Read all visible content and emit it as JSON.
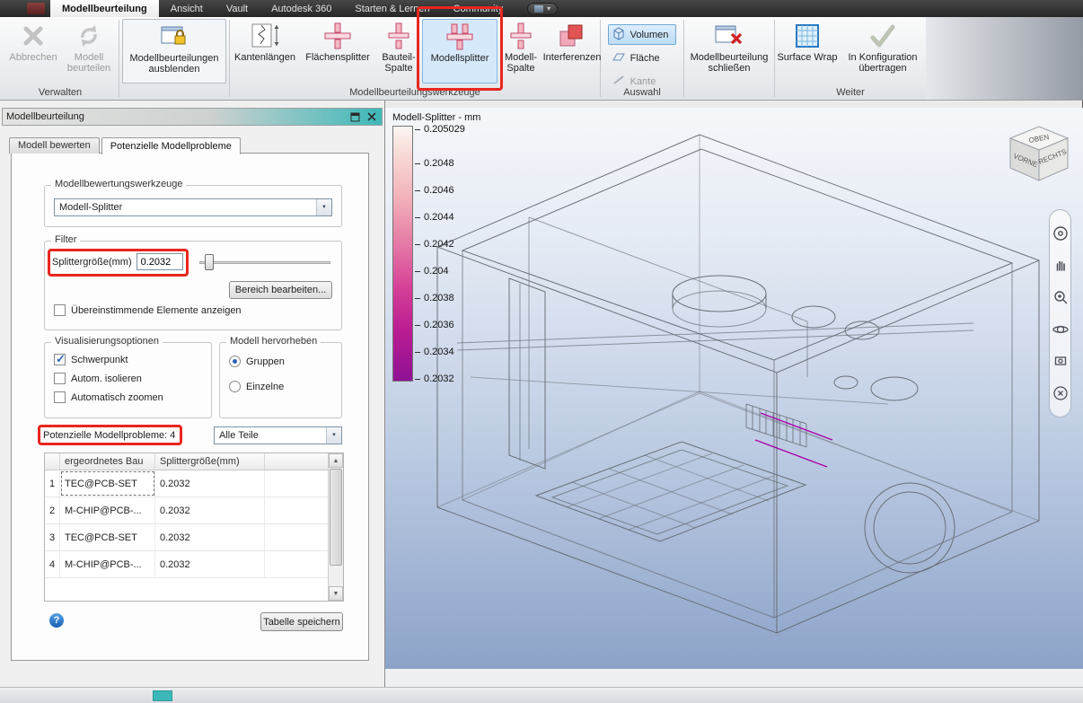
{
  "tabbar": {
    "tabs": [
      {
        "label": "Modellbeurteilung",
        "active": true
      },
      {
        "label": "Ansicht",
        "active": false
      },
      {
        "label": "Vault",
        "active": false
      },
      {
        "label": "Autodesk 360",
        "active": false
      },
      {
        "label": "Starten & Lernen",
        "active": false
      },
      {
        "label": "Community",
        "active": false
      }
    ]
  },
  "ribbon": {
    "group_labels": [
      "Verwalten",
      "",
      "Modellbeurteilungswerkzeuge",
      "Auswahl",
      "",
      "Weiter"
    ],
    "buttons": {
      "abbrechen": {
        "label": "Abbrechen",
        "disabled": true
      },
      "beurteilen": {
        "label": "Modell beurteilen",
        "disabled": true
      },
      "ausblenden": {
        "label": "Modellbeurteilungen ausblenden"
      },
      "kantenlaengen": {
        "label": "Kantenlängen"
      },
      "flaechensplitter": {
        "label": "Flächensplitter"
      },
      "bauteil_spalte": {
        "label": "Bauteil-Spalte"
      },
      "modellsplitter": {
        "label": "Modellsplitter",
        "selected": true
      },
      "modell_spalte": {
        "label": "Modell-Spalte"
      },
      "interferenzen": {
        "label": "Interferenzen"
      },
      "volumen": {
        "label": "Volumen",
        "selected": true
      },
      "flaeche": {
        "label": "Fläche"
      },
      "kante": {
        "label": "Kante",
        "disabled": true
      },
      "schliessen": {
        "label": "Modellbeurteilung schließen"
      },
      "surface_wrap": {
        "label": "Surface Wrap"
      },
      "konfiguration": {
        "label": "In Konfiguration übertragen"
      }
    }
  },
  "panel": {
    "title": "Modellbeurteilung",
    "tabs": [
      {
        "label": "Modell bewerten",
        "active": false
      },
      {
        "label": "Potenzielle Modellprobleme",
        "active": true
      }
    ],
    "groups": {
      "werkzeuge": {
        "label": "Modellbewertungswerkzeuge",
        "combo": "Modell-Splitter"
      },
      "filter": {
        "label": "Filter",
        "size_label": "Splittergröße(mm)",
        "size_value": "0.2032",
        "bereich": "Bereich bearbeiten...",
        "match_label": "Übereinstimmende Elemente anzeigen",
        "match_checked": false
      },
      "visual": {
        "label": "Visualisierungsoptionen",
        "options": [
          {
            "label": "Schwerpunkt",
            "checked": true
          },
          {
            "label": "Autom. isolieren",
            "checked": false
          },
          {
            "label": "Automatisch zoomen",
            "checked": false
          }
        ]
      },
      "hervorheben": {
        "label": "Modell hervorheben",
        "options": [
          {
            "label": "Gruppen",
            "selected": true
          },
          {
            "label": "Einzelne",
            "selected": false
          }
        ]
      }
    },
    "probleme_label": "Potenzielle Modellprobleme: 4",
    "parts_filter": "Alle Teile",
    "table": {
      "headers": [
        "ergeordnetes Bau",
        "Splittergröße(mm)"
      ],
      "rows": [
        {
          "num": "1",
          "part": "TEC@PCB-SET",
          "size": "0.2032"
        },
        {
          "num": "2",
          "part": "M-CHIP@PCB-...",
          "size": "0.2032"
        },
        {
          "num": "3",
          "part": "TEC@PCB-SET",
          "size": "0.2032"
        },
        {
          "num": "4",
          "part": "M-CHIP@PCB-...",
          "size": "0.2032"
        }
      ]
    },
    "save_button": "Tabelle speichern"
  },
  "viewport": {
    "legend": {
      "title": "Modell-Splitter - mm",
      "top_label": "0.205029",
      "ticks": [
        "0.2048",
        "0.2046",
        "0.2044",
        "0.2042",
        "0.204",
        "0.2038",
        "0.2036",
        "0.2034",
        "0.2032"
      ]
    },
    "viewcube": {
      "top": "OBEN",
      "front": "VORNE",
      "right": "RECHTS"
    }
  },
  "colors": {
    "annotation_red": "#e8261f",
    "selection_blue": "#d6e9fb",
    "panel_header_teal": "#3db8b8",
    "legend_top": "#fdf7f5",
    "legend_bottom": "#8f1195",
    "highlight_magenta": "#a800a8"
  }
}
